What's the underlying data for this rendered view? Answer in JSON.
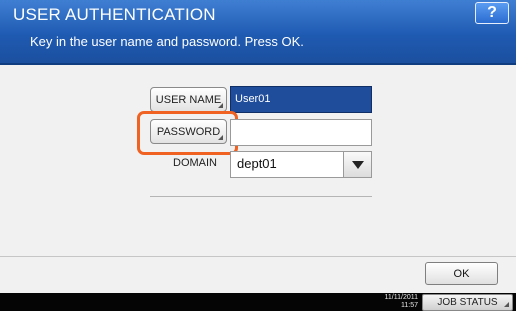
{
  "header": {
    "title": "USER AUTHENTICATION",
    "instruction": "Key in the user name and password. Press OK.",
    "help_label": "?"
  },
  "form": {
    "username_label": "USER NAME",
    "username_value": "User01",
    "password_label": "PASSWORD",
    "password_value": "",
    "domain_label": "DOMAIN",
    "domain_value": "dept01"
  },
  "footer": {
    "ok_label": "OK",
    "date": "11/11/2011",
    "time": "11:57",
    "job_status_label": "JOB STATUS"
  },
  "colors": {
    "header_blue": "#1f5bb2",
    "selected_field": "#1f4d9c",
    "highlight_orange": "#f06222"
  }
}
